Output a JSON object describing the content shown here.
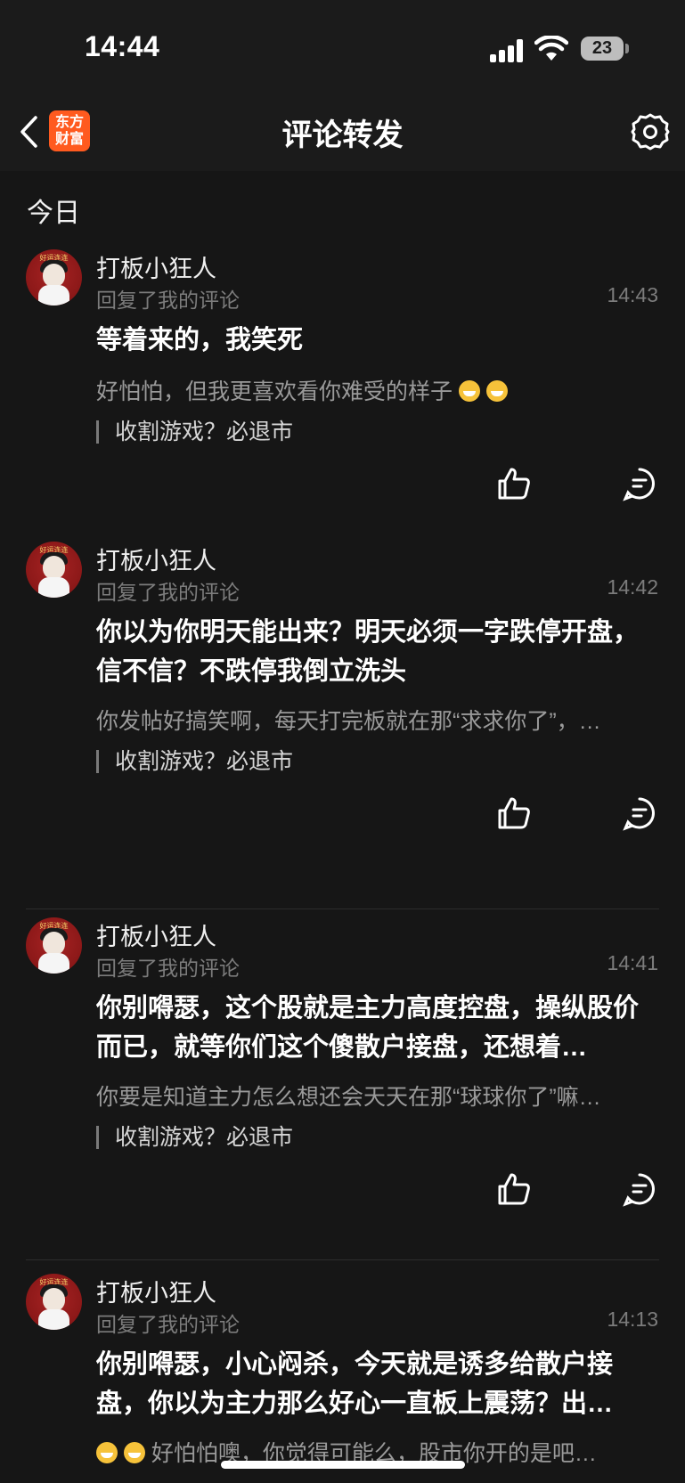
{
  "status_bar": {
    "time": "14:44",
    "battery": "23"
  },
  "nav": {
    "title": "评论转发",
    "logo_line1": "东方",
    "logo_line2": "财富"
  },
  "section": {
    "label": "今日"
  },
  "avatar_tag": "好运连连",
  "items": [
    {
      "username": "打板小狂人",
      "subtitle": "回复了我的评论",
      "time": "14:43",
      "content": "等着来的，我笑死",
      "reply": "好怕怕，但我更喜欢看你难受的样子",
      "reply_emojis": [
        "grinning-emoji",
        "grinning-emoji"
      ],
      "quote": "收割游戏？必退市"
    },
    {
      "username": "打板小狂人",
      "subtitle": "回复了我的评论",
      "time": "14:42",
      "content": "你以为你明天能出来？明天必须一字跌停开盘，信不信？不跌停我倒立洗头",
      "reply": "你发帖好搞笑啊，每天打完板就在那“求求你了”，…",
      "quote": "收割游戏？必退市"
    },
    {
      "username": "打板小狂人",
      "subtitle": "回复了我的评论",
      "time": "14:41",
      "content": "你别嘚瑟，这个股就是主力高度控盘，操纵股价而已，就等你们这个傻散户接盘，还想着…",
      "reply": "你要是知道主力怎么想还会天天在那“球球你了”嘛…",
      "quote": "收割游戏？必退市"
    },
    {
      "username": "打板小狂人",
      "subtitle": "回复了我的评论",
      "time": "14:13",
      "content": "你别嘚瑟，小心闷杀，今天就是诱多给散户接盘，你以为主力那么好心一直板上震荡？出…",
      "reply": "好怕怕噢，你觉得可能么，股市你开的是吧…",
      "reply_emojis": [
        "grinning-emoji",
        "grinning-emoji"
      ]
    }
  ]
}
